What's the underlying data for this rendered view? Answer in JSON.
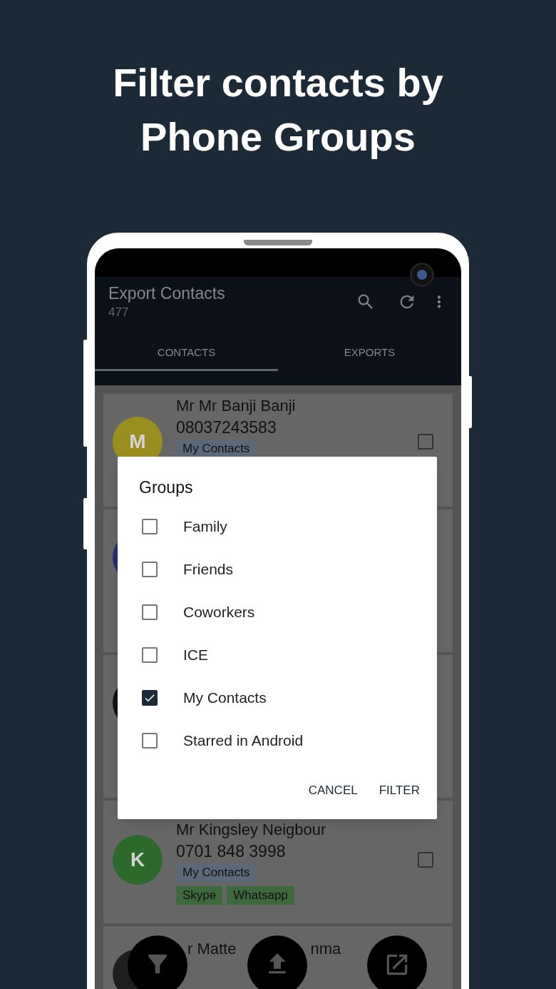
{
  "headline": "Filter contacts by Phone Groups",
  "app_bar": {
    "title": "Export Contacts",
    "subtitle": "477"
  },
  "tabs": [
    {
      "label": "CONTACTS",
      "selected": true
    },
    {
      "label": "EXPORTS",
      "selected": false
    }
  ],
  "contacts": [
    {
      "avatar": "M",
      "color": "#9a8f1e",
      "name": "Mr Mr Banji Banji",
      "phone": "08037243583",
      "tags": [
        {
          "label": "My Contacts",
          "kind": "group"
        }
      ],
      "checked": false
    },
    {
      "color": "#27306e"
    },
    {
      "color": "#121212"
    },
    {
      "avatar": "K",
      "color": "#2c6a2c",
      "name": "Mr Kingsley Neigbour",
      "phone": "0701 848 3998",
      "tags": [
        {
          "label": "My Contacts",
          "kind": "group"
        },
        {
          "label": "Skype",
          "kind": "app"
        },
        {
          "label": "Whatsapp",
          "kind": "app"
        }
      ],
      "checked": false
    },
    {
      "color": "#1e1e1e",
      "name_parts": [
        "r Matte",
        "nma"
      ]
    }
  ],
  "dialog": {
    "title": "Groups",
    "options": [
      {
        "label": "Family",
        "checked": false
      },
      {
        "label": "Friends",
        "checked": false
      },
      {
        "label": "Coworkers",
        "checked": false
      },
      {
        "label": "ICE",
        "checked": false
      },
      {
        "label": "My Contacts",
        "checked": true
      },
      {
        "label": "Starred in Android",
        "checked": false
      }
    ],
    "buttons": [
      "CANCEL",
      "FILTER"
    ]
  }
}
